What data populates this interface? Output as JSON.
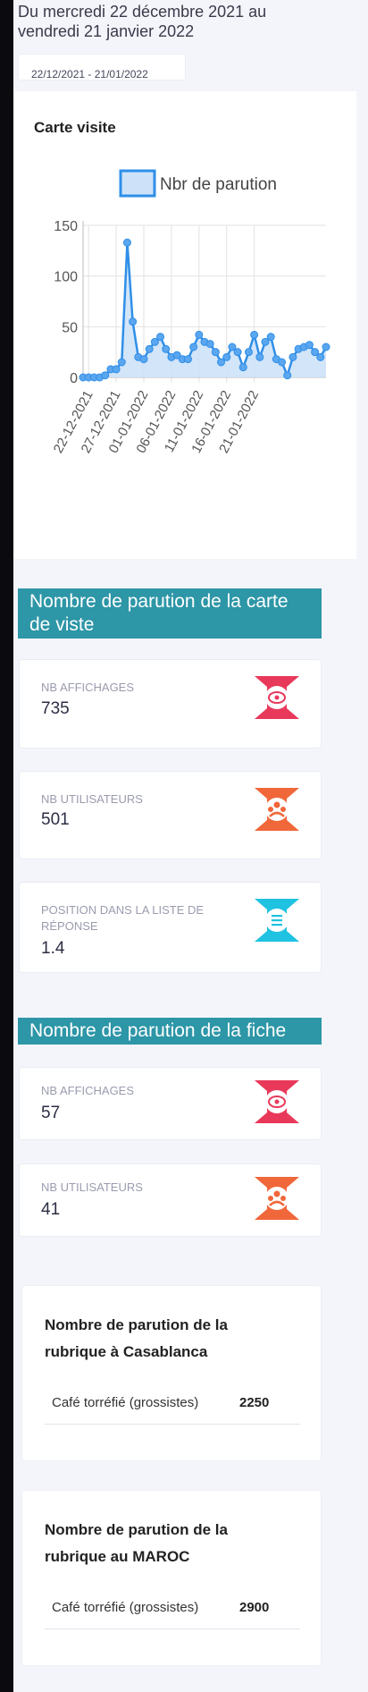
{
  "header": {
    "date_title": "Du mercredi 22 décembre 2021 au vendredi 21 janvier 2022",
    "date_range": "22/12/2021 - 21/01/2022"
  },
  "chart_card": {
    "title": "Carte visite"
  },
  "chart_data": {
    "type": "area",
    "title": "",
    "legend": [
      "Nbr de parution"
    ],
    "legend_position": "top",
    "series": [
      {
        "name": "Nbr de parution",
        "values": [
          0,
          0,
          0,
          0,
          2,
          8,
          8,
          15,
          133,
          55,
          20,
          18,
          28,
          35,
          40,
          28,
          20,
          22,
          18,
          18,
          30,
          42,
          35,
          33,
          25,
          15,
          20,
          30,
          25,
          10,
          25,
          42,
          20,
          35,
          40,
          18,
          15,
          2,
          20,
          28,
          30,
          32,
          25,
          20,
          30
        ]
      }
    ],
    "x_tick_labels": [
      "22-12-2021",
      "27-12-2021",
      "01-01-2022",
      "06-01-2022",
      "11-01-2022",
      "16-01-2022",
      "21-01-2022"
    ],
    "y_ticks": [
      0,
      50,
      100,
      150
    ],
    "ylim": [
      0,
      150
    ],
    "grid": true,
    "colors": {
      "line": "#2f8fe8",
      "fill": "#cde2f8",
      "point": "#5aa6ef"
    }
  },
  "section1": {
    "title": "Nombre de parution de la carte de viste",
    "stats": [
      {
        "label": "NB AFFICHAGES",
        "value": "735",
        "icon": "eye-icon",
        "color": "#e8395a"
      },
      {
        "label": "NB UTILISATEURS",
        "value": "501",
        "icon": "users-icon",
        "color": "#f0673a"
      },
      {
        "label": "POSITION DANS LA LISTE DE RÉPONSE",
        "value": "1.4",
        "icon": "list-icon",
        "color": "#1fc2e0"
      }
    ]
  },
  "section2": {
    "title": "Nombre de parution de la fiche",
    "stats": [
      {
        "label": "NB AFFICHAGES",
        "value": "57",
        "icon": "eye-icon",
        "color": "#e8395a"
      },
      {
        "label": "NB UTILISATEURS",
        "value": "41",
        "icon": "users-icon",
        "color": "#f0673a"
      }
    ]
  },
  "rubriques": [
    {
      "title": "Nombre de parution de la rubrique à Casablanca",
      "category": "Café torréfié (grossistes)",
      "value": "2250"
    },
    {
      "title": "Nombre de parution de la rubrique au MAROC",
      "category": "Café torréfié (grossistes)",
      "value": "2900"
    }
  ]
}
